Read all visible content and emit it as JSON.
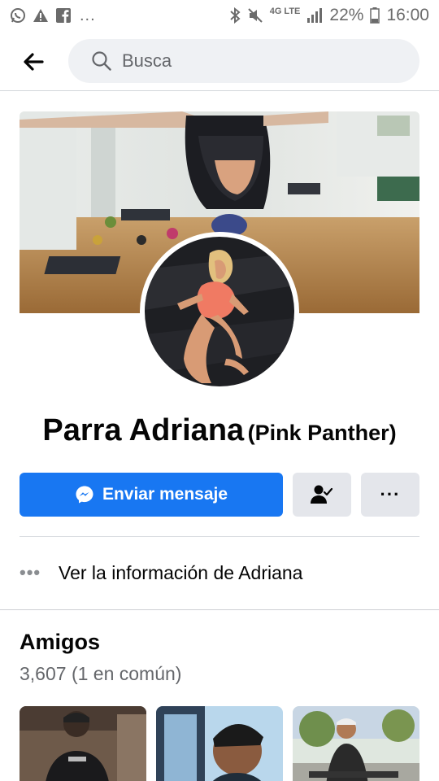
{
  "status_bar": {
    "icons_left": [
      "whatsapp-icon",
      "warning-icon",
      "facebook-icon"
    ],
    "more_indicator": "...",
    "icons_right": [
      "bluetooth-icon",
      "mute-icon",
      "signal-icon",
      "battery-icon"
    ],
    "network": "4G LTE",
    "battery": "22%",
    "time": "16:00"
  },
  "search": {
    "placeholder": "Busca"
  },
  "profile": {
    "name": "Parra Adriana",
    "alternate_name": "(Pink Panther)"
  },
  "actions": {
    "message_label": "Enviar mensaje",
    "friend_button_icon": "friends-check-icon",
    "more_label": "···"
  },
  "info": {
    "dots": "•••",
    "label": "Ver la información de Adriana"
  },
  "friends": {
    "title": "Amigos",
    "count_text": "3,607 (1 en común)"
  },
  "colors": {
    "accent": "#1877f2",
    "button_grey": "#e4e6eb",
    "search_bg": "#eff1f4",
    "secondary_text": "#65676b"
  }
}
